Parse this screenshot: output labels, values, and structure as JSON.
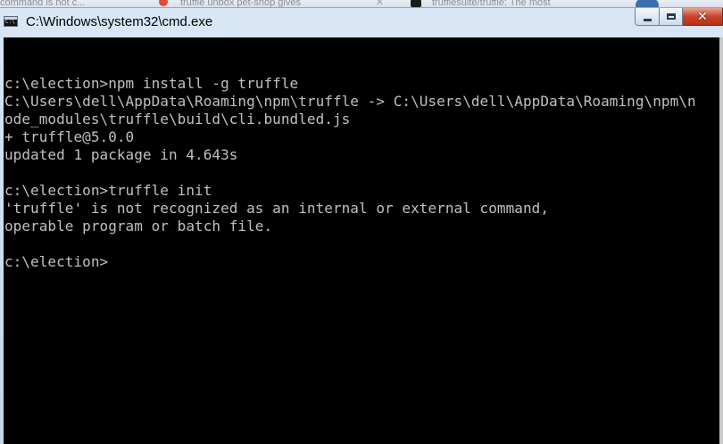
{
  "window": {
    "title": "C:\\Windows\\system32\\cmd.exe",
    "controls": {
      "minimize": "minimize",
      "maximize": "maximize",
      "close": "close"
    }
  },
  "background_tabs": [
    {
      "label": "command is not c..."
    },
    {
      "label": "truffle unbox pet-shop gives"
    },
    {
      "label": "trufflesuite/truffle: The most"
    }
  ],
  "console": {
    "lines": [
      "",
      "c:\\election>npm install -g truffle",
      "C:\\Users\\dell\\AppData\\Roaming\\npm\\truffle -> C:\\Users\\dell\\AppData\\Roaming\\npm\\n",
      "ode_modules\\truffle\\build\\cli.bundled.js",
      "+ truffle@5.0.0",
      "updated 1 package in 4.643s",
      "",
      "c:\\election>truffle init",
      "'truffle' is not recognized as an internal or external command,",
      "operable program or batch file.",
      "",
      "c:\\election>"
    ]
  },
  "colors": {
    "console_bg": "#000000",
    "console_fg": "#c0c0c0",
    "titlebar": "#d8e6f5",
    "close_button": "#c8432a"
  }
}
